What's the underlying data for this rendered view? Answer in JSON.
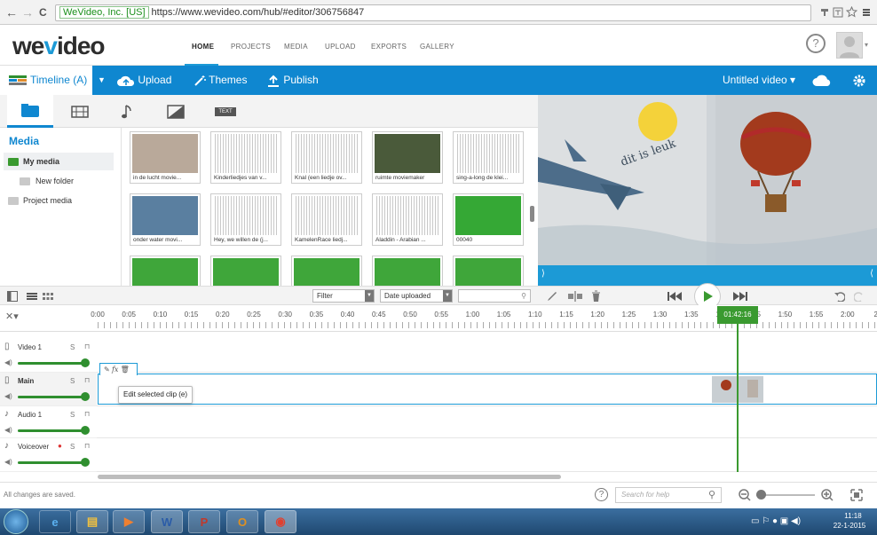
{
  "browser": {
    "nav_back": "←",
    "nav_forward": "→",
    "nav_reload": "C",
    "secure_label": "WeVideo, Inc. [US]",
    "url": "https://www.wevideo.com/hub/#editor/306756847"
  },
  "site": {
    "logo_we": "we",
    "logo_v": "v",
    "logo_rest": "ideo",
    "nav": [
      "HOME",
      "PROJECTS",
      "MEDIA",
      "UPLOAD",
      "EXPORTS",
      "GALLERY"
    ],
    "help_glyph": "?"
  },
  "toolbar": {
    "timeline_label": "Timeline (A)",
    "upload_label": "Upload",
    "themes_label": "Themes",
    "publish_label": "Publish",
    "video_title": "Untitled video ▾"
  },
  "media": {
    "tab_text_label": "TEXT",
    "title": "Media",
    "my_media": "My media",
    "new_folder": "New folder",
    "project_media": "Project media",
    "thumbs": [
      {
        "caption": "in de lucht movie...",
        "kind": "video",
        "color": "#b9a99a"
      },
      {
        "caption": "Kinderliedjes van v...",
        "kind": "audio",
        "color": "#ffffff"
      },
      {
        "caption": "Knal (een liedje ov...",
        "kind": "audio",
        "color": "#ffffff"
      },
      {
        "caption": "ruimte moviemaker",
        "kind": "video",
        "color": "#4a5a3a"
      },
      {
        "caption": "sing-a-long de klei...",
        "kind": "audio",
        "color": "#ffffff"
      },
      {
        "caption": "onder water movi...",
        "kind": "video",
        "color": "#5a7fa0"
      },
      {
        "caption": "Hey, we willen de (j...",
        "kind": "audio",
        "color": "#ffffff"
      },
      {
        "caption": "KamelenRace liedj...",
        "kind": "audio",
        "color": "#ffffff"
      },
      {
        "caption": "Aladdin - Arabian ...",
        "kind": "audio",
        "color": "#ffffff"
      },
      {
        "caption": "00040",
        "kind": "video",
        "color": "#35a835"
      },
      {
        "caption": "",
        "kind": "video",
        "color": "#3fa63a"
      },
      {
        "caption": "",
        "kind": "video",
        "color": "#3fa63a"
      },
      {
        "caption": "",
        "kind": "video",
        "color": "#3fa63a"
      },
      {
        "caption": "",
        "kind": "video",
        "color": "#3fa63a"
      },
      {
        "caption": "",
        "kind": "video",
        "color": "#3fa63a"
      }
    ],
    "filter_label": "Filter",
    "sort_label": "Date uploaded",
    "search_placeholder": ""
  },
  "preview": {
    "sign_text": "dit is leuk"
  },
  "ruler": {
    "ticks": [
      "0:00",
      "0:05",
      "0:10",
      "0:15",
      "0:20",
      "0:25",
      "0:30",
      "0:35",
      "0:40",
      "0:45",
      "0:50",
      "0:55",
      "1:00",
      "1:05",
      "1:10",
      "1:15",
      "1:20",
      "1:25",
      "1:30",
      "1:35",
      "1:40",
      "1:45",
      "1:50",
      "1:55",
      "2:00",
      "2:0"
    ],
    "playhead_time": "01:42:16"
  },
  "tracks": [
    {
      "name": "Video 1",
      "solo": "S",
      "bold": false
    },
    {
      "name": "Main",
      "solo": "S",
      "bold": true
    },
    {
      "name": "Audio 1",
      "solo": "S",
      "bold": false
    },
    {
      "name": "Voiceover",
      "solo": "S",
      "bold": false
    }
  ],
  "clip": {
    "toolbar_fx": "fx",
    "tooltip": "Edit selected clip (e)"
  },
  "status": {
    "saved_text": "All changes are saved.",
    "help_placeholder": "Search for help"
  },
  "taskbar": {
    "time": "11:18",
    "date": "22-1-2015",
    "apps": [
      "e",
      "▤",
      "▶",
      "W",
      "P",
      "O",
      "◉"
    ]
  },
  "colors": {
    "accent": "#0f87d0",
    "playhead": "#3a9a30"
  }
}
